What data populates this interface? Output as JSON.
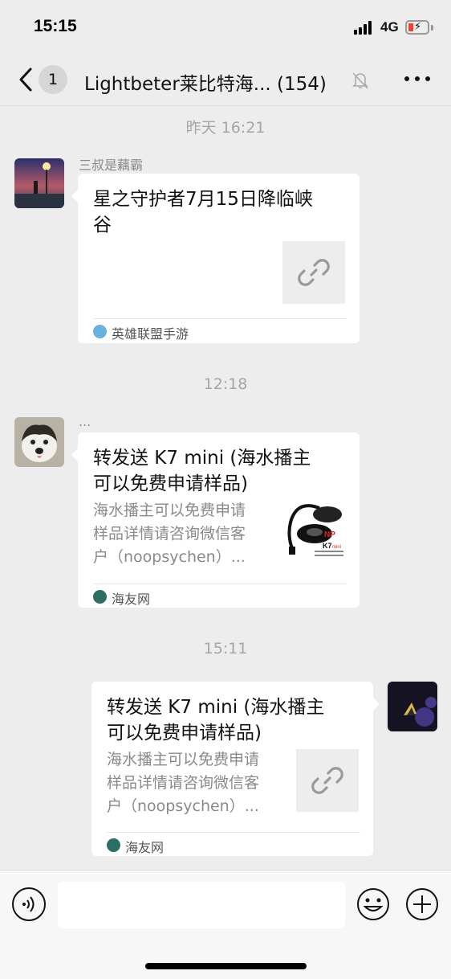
{
  "status_bar": {
    "time": "15:15",
    "network": "4G"
  },
  "nav": {
    "back_badge": "1",
    "title": "Lightbeter莱比特海...  (154)"
  },
  "colors": {
    "background": "#ededed",
    "bubble": "#ffffff",
    "timestamp": "#a5a5a5",
    "battery_low": "#ff3b30"
  },
  "messages": [
    {
      "timestamp": "昨天 16:21",
      "sender": "三叔是藕霸",
      "title_line1": "星之守护者7月15日降临峡",
      "title_line2": "谷",
      "source": "英雄联盟手游",
      "thumb_icon": "link-icon"
    },
    {
      "timestamp": "12:18",
      "sender": "...",
      "title_line1": "转发送 K7 mini (海水播主",
      "title_line2": "可以免费申请样品)",
      "desc_line1": "海水播主可以免费申请",
      "desc_line2": "样品详情请咨询微信客",
      "desc_line3": "户（noopsychen）...",
      "source": "海友网",
      "thumb_icon": "product-image"
    },
    {
      "timestamp": "15:11",
      "title_line1": "转发送 K7 mini (海水播主",
      "title_line2": "可以免费申请样品)",
      "desc_line1": "海水播主可以免费申请",
      "desc_line2": "样品详情请咨询微信客",
      "desc_line3": "户（noopsychen）...",
      "source": "海友网",
      "thumb_icon": "link-icon"
    }
  ],
  "product_image": {
    "logo": "NP",
    "model": "K7",
    "model_suffix": "mini"
  },
  "input": {
    "value": ""
  }
}
